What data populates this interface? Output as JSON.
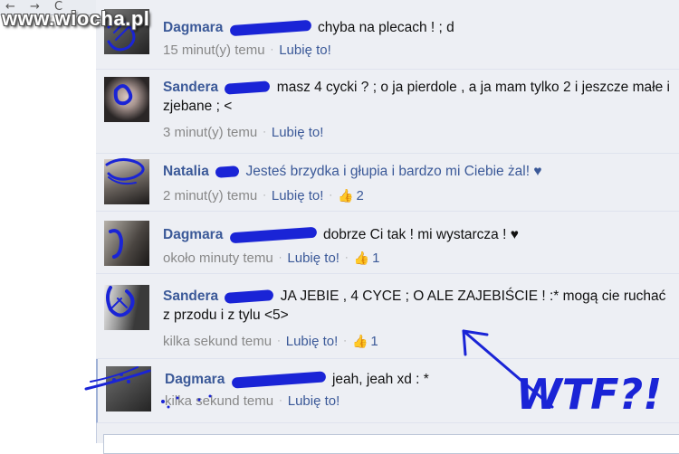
{
  "watermark": "www.wiocha.pl",
  "comments": [
    {
      "name": "Dagmara",
      "text": "chyba na plecach ! ; d",
      "time": "15 minut(y) temu",
      "like_label": "Lubię to!",
      "likes": ""
    },
    {
      "name": "Sandera",
      "text": "masz 4 cycki ? ; o ja pierdole , a ja mam tylko 2 i jeszcze małe i zjebane ; <",
      "time": "3 minut(y) temu",
      "like_label": "Lubię to!",
      "likes": ""
    },
    {
      "name": "Natalia",
      "text": "Jesteś brzydka i głupia i bardzo mi Ciebie żal! ♥",
      "time": "2 minut(y) temu",
      "like_label": "Lubię to!",
      "likes": "2"
    },
    {
      "name": "Dagmara",
      "text": "dobrze Ci tak ! mi wystarcza ! ♥",
      "time": "około minuty temu",
      "like_label": "Lubię to!",
      "likes": "1"
    },
    {
      "name": "Sandera",
      "text": "JA JEBIE , 4 CYCE ; O ALE ZAJEBIŚCIE ! :* mogą cie ruchać z przodu i z tylu <5>",
      "time": "kilka sekund temu",
      "like_label": "Lubię to!",
      "likes": "1"
    },
    {
      "name": "Dagmara",
      "text": "jeah, jeah xd : *",
      "time": "kilka sekund temu",
      "like_label": "Lubię to!",
      "likes": ""
    }
  ],
  "annotation": "WTF?!",
  "colors": {
    "link": "#3b5998",
    "panel": "#edeff4",
    "scribble": "#1a24d6"
  }
}
